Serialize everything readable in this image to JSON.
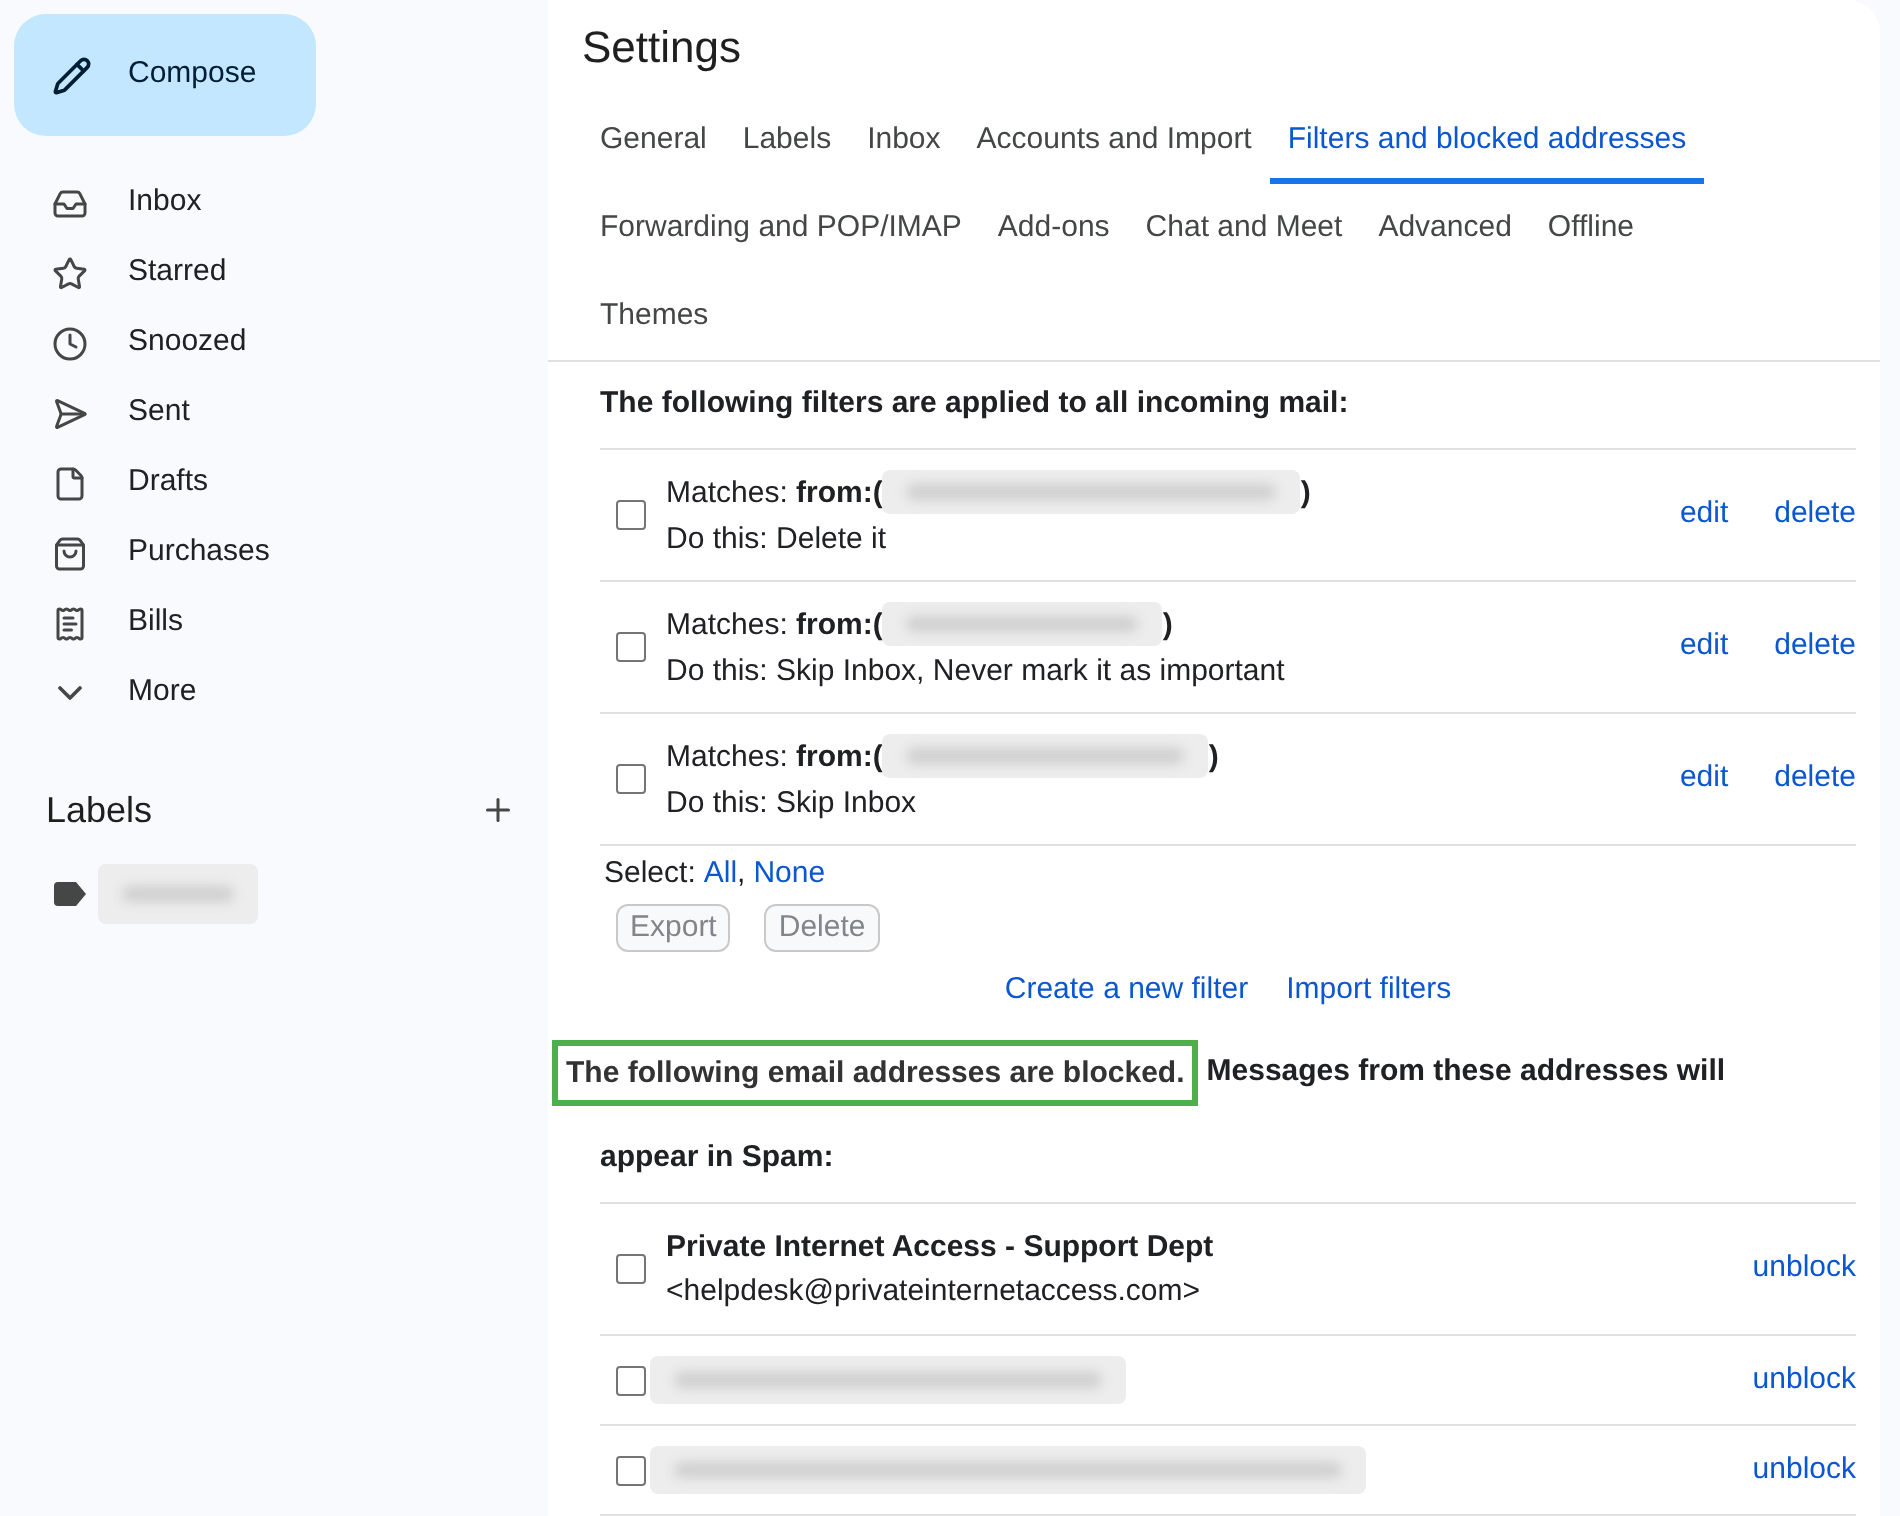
{
  "sidebar": {
    "compose": "Compose",
    "items": [
      {
        "label": "Inbox",
        "selected": false
      },
      {
        "label": "Starred",
        "selected": false
      },
      {
        "label": "Snoozed",
        "selected": false
      },
      {
        "label": "Sent",
        "selected": false
      },
      {
        "label": "Drafts",
        "selected": false
      },
      {
        "label": "Purchases",
        "selected": false
      },
      {
        "label": "Bills",
        "selected": false
      },
      {
        "label": "More",
        "selected": false
      }
    ],
    "labels": {
      "title": "Labels",
      "items": [
        {
          "kind": "redacted"
        }
      ]
    }
  },
  "settings": {
    "title": "Settings",
    "tabs": [
      {
        "label": "General",
        "selected": false
      },
      {
        "label": "Labels",
        "selected": false
      },
      {
        "label": "Inbox",
        "selected": false
      },
      {
        "label": "Accounts and Import",
        "selected": false
      },
      {
        "label": "Filters and blocked addresses",
        "selected": true
      },
      {
        "label": "Forwarding and POP/IMAP",
        "selected": false
      },
      {
        "label": "Add-ons",
        "selected": false
      },
      {
        "label": "Chat and Meet",
        "selected": false
      },
      {
        "label": "Advanced",
        "selected": false
      },
      {
        "label": "Offline",
        "selected": false
      },
      {
        "label": "Themes",
        "selected": false
      }
    ]
  },
  "filters": {
    "heading": "The following filters are applied to all incoming mail:",
    "rows": [
      {
        "checked": false,
        "match_label": "Matches: **from:(**",
        "match_close": ")",
        "action": "Do this: Delete it",
        "edit": "edit",
        "delete": "delete"
      },
      {
        "checked": false,
        "match_label": "Matches: **from:(**",
        "match_close": ")",
        "action": "Do this: Skip Inbox, Never mark it as important",
        "edit": "edit",
        "delete": "delete"
      },
      {
        "checked": false,
        "match_label": "Matches: **from:(**",
        "match_close": ")",
        "action": "Do this: Skip Inbox",
        "edit": "edit",
        "delete": "delete"
      }
    ],
    "select": {
      "label": "Select:",
      "all": "All",
      "separator": ",",
      "none": "None"
    },
    "buttons": [
      {
        "label": "Export",
        "disabled": true
      },
      {
        "label": "Delete",
        "disabled": true
      }
    ],
    "links": [
      "Create a new filter",
      "Import filters"
    ]
  },
  "blocked": {
    "heading": {
      "highlighted": true,
      "highlighted_text": "The following email addresses are blocked.",
      "text_lines": [
        "Messages from these addresses will",
        "appear in Spam:"
      ]
    },
    "rows": [
      {
        "kind": "contact",
        "checked": false,
        "name": "Private Internet Access - Support Dept",
        "email": "<helpdesk@privateinternetaccess.com>",
        "action": "unblock"
      },
      {
        "kind": "redacted",
        "checked": false,
        "action": "unblock"
      },
      {
        "kind": "redacted",
        "checked": false,
        "action": "unblock"
      }
    ]
  }
}
